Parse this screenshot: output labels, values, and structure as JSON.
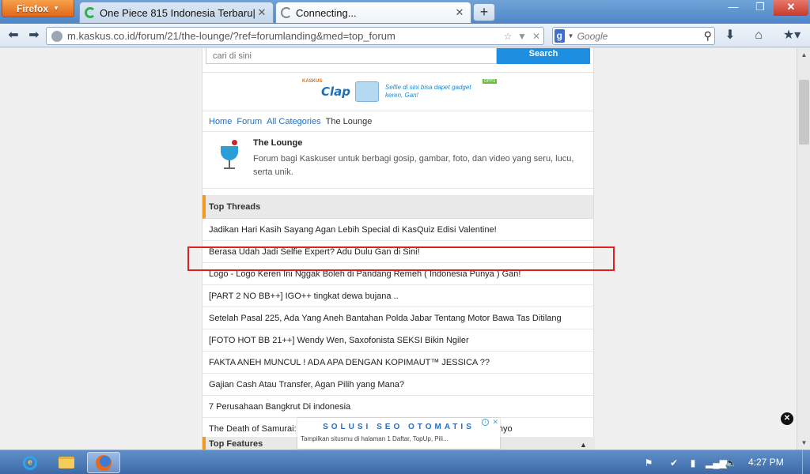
{
  "browser": {
    "menu_button": "Firefox",
    "tabs": [
      {
        "title": "One Piece 815 Indonesia Terbaru|Bac...",
        "active": false
      },
      {
        "title": "Connecting...",
        "active": true
      }
    ],
    "new_tab": "+",
    "window_controls": {
      "minimize": "—",
      "restore": "❐",
      "close": "✕"
    },
    "url": "m.kaskus.co.id/forum/21/the-lounge/?ref=forumlanding&med=top_forum",
    "search_placeholder": "Google",
    "search_engine_icon": "g"
  },
  "page": {
    "search": {
      "placeholder": "cari di sini",
      "button": "Search"
    },
    "banner": {
      "badge": "KASKUS",
      "brand": "Clap",
      "text": "Selfie di sini bisa dapet gadget keren, Gan!",
      "corner": "OPPO"
    },
    "breadcrumb": [
      "Home",
      "Forum",
      "All Categories"
    ],
    "breadcrumb_current": "The Lounge",
    "forum": {
      "title": "The Lounge",
      "description": "Forum bagi Kaskuser untuk berbagi gosip, gambar, foto, dan video yang seru, lucu, serta unik."
    },
    "top_threads_label": "Top Threads",
    "threads": [
      "Jadikan Hari Kasih Sayang Agan Lebih Special di KasQuiz Edisi Valentine!",
      "Berasa Udah Jadi Selfie Expert? Adu Dulu Gan di Sini!",
      "Logo - Logo Keren Ini Nggak Boleh di Pandang Remeh ( Indonesia Punya ) Gan!",
      "[PART 2 NO BB++] IGO++ tingkat dewa bujana ..",
      "Setelah Pasal 225, Ada Yang Aneh Bantahan Polda Jabar Tentang Motor Bawa Tas Ditilang",
      "[FOTO HOT BB 21++] Wendy Wen, Saxofonista SEKSI Bikin Ngiler",
      "FAKTA ANEH MUNCUL ! ADA APA DENGAN KOPIMAUT™ JESSICA ??",
      "Gajian Cash Atau Transfer, Agan Pilih yang Mana?",
      "7 Perusahaan Bangkrut Di indonesia",
      "The Death of Samurai: Robohnya Sony, Panasonic, Sharp, Toshiba dan Sanyo"
    ],
    "top_features_label": "Top Features",
    "ad_overlay": {
      "title": "SOLUSI SEO OTOMATIS",
      "text": "Tampilkan situsmu di halaman 1 Daftar, TopUp, Pili...",
      "info": "i",
      "close": "✕"
    },
    "scroll_top": "▲"
  },
  "taskbar": {
    "clock": "4:27 PM"
  },
  "colors": {
    "link": "#1e6fc9",
    "accent_orange": "#f29a1f",
    "search_button": "#1e8fe0",
    "highlight": "#e02020"
  }
}
